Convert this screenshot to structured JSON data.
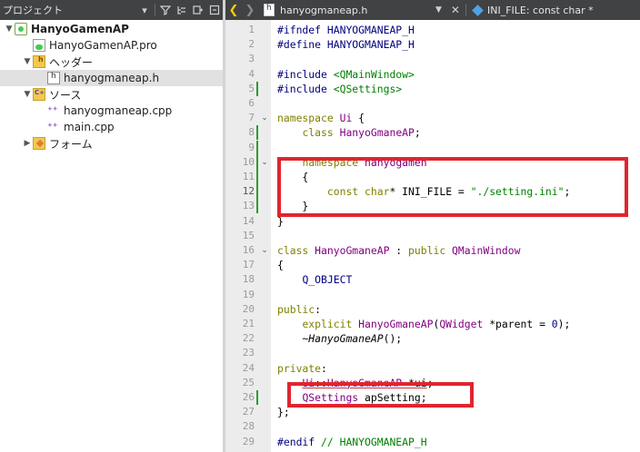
{
  "left_panel": {
    "title": "プロジェクト",
    "toolbar_icons": [
      "chevron-down-icon",
      "filter-icon",
      "link-icon",
      "split-icon",
      "close-panel-icon"
    ],
    "tree": [
      {
        "label": "HanyoGamenAP",
        "kind": "project",
        "expanded": true
      },
      {
        "label": "HanyoGamenAP.pro",
        "kind": "pro-file"
      },
      {
        "label": "ヘッダー",
        "kind": "header-folder",
        "expanded": true
      },
      {
        "label": "hanyogmaneap.h",
        "kind": "header-file",
        "selected": true
      },
      {
        "label": "ソース",
        "kind": "source-folder",
        "expanded": true
      },
      {
        "label": "hanyogmaneap.cpp",
        "kind": "cpp-file"
      },
      {
        "label": "main.cpp",
        "kind": "cpp-file"
      },
      {
        "label": "フォーム",
        "kind": "form-folder",
        "expanded": false
      }
    ]
  },
  "editor_toolbar": {
    "file_name": "hanyogmaneap.h",
    "symbol": "INI_FILE: const char *"
  },
  "editor": {
    "current_line": 12,
    "modified_lines": [
      5,
      8,
      9,
      10,
      11,
      12,
      13,
      26
    ],
    "folded_markers": [
      7,
      10,
      16
    ],
    "lines": [
      {
        "n": "1",
        "text": "#ifndef HANYOGMANEAP_H"
      },
      {
        "n": "2",
        "text": "#define HANYOGMANEAP_H"
      },
      {
        "n": "3",
        "text": ""
      },
      {
        "n": "4",
        "text": "#include <QMainWindow>"
      },
      {
        "n": "5",
        "text": "#include <QSettings>"
      },
      {
        "n": "6",
        "text": ""
      },
      {
        "n": "7",
        "text": "namespace Ui {"
      },
      {
        "n": "8",
        "text": "    class HanyoGmaneAP;"
      },
      {
        "n": "9",
        "text": ""
      },
      {
        "n": "10",
        "text": "    namespace hanyogamen"
      },
      {
        "n": "11",
        "text": "    {"
      },
      {
        "n": "12",
        "text": "        const char* INI_FILE = \"./setting.ini\";"
      },
      {
        "n": "13",
        "text": "    }"
      },
      {
        "n": "14",
        "text": "}"
      },
      {
        "n": "15",
        "text": ""
      },
      {
        "n": "16",
        "text": "class HanyoGmaneAP : public QMainWindow"
      },
      {
        "n": "17",
        "text": "{"
      },
      {
        "n": "18",
        "text": "    Q_OBJECT"
      },
      {
        "n": "19",
        "text": ""
      },
      {
        "n": "20",
        "text": "public:"
      },
      {
        "n": "21",
        "text": "    explicit HanyoGmaneAP(QWidget *parent = 0);"
      },
      {
        "n": "22",
        "text": "    ~HanyoGmaneAP();"
      },
      {
        "n": "23",
        "text": ""
      },
      {
        "n": "24",
        "text": "private:"
      },
      {
        "n": "25",
        "text": "    Ui::HanyoGmaneAP *ui;"
      },
      {
        "n": "26",
        "text": "    QSettings apSetting;"
      },
      {
        "n": "27",
        "text": "};"
      },
      {
        "n": "28",
        "text": ""
      },
      {
        "n": "29",
        "text": "#endif // HANYOGMANEAP_H"
      }
    ]
  },
  "annotation_color": "#e0252e"
}
